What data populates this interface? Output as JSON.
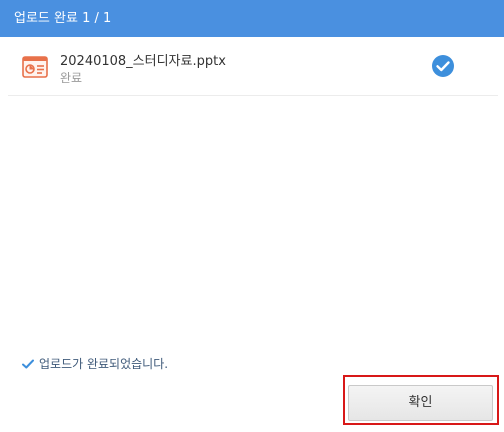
{
  "header": {
    "title": "업로드 완료 1 / 1"
  },
  "file": {
    "name": "20240108_스터디자료.pptx",
    "status": "완료",
    "icon": "pptx-file-icon",
    "status_icon": "check-circle-icon"
  },
  "footer": {
    "message": "업로드가 완료되었습니다.",
    "message_icon": "checkmark-icon",
    "confirm_label": "확인"
  },
  "colors": {
    "header_bg": "#4a90e0",
    "check": "#3d8fdc",
    "file_icon": "#e8714a",
    "highlight": "#d81818"
  }
}
